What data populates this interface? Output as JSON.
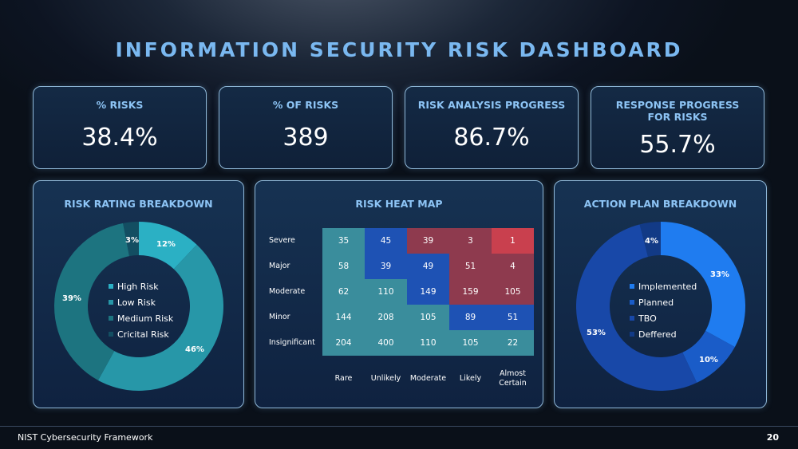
{
  "title": "INFORMATION SECURITY RISK DASHBOARD",
  "kpis": [
    {
      "label": "% RISKS",
      "value": "38.4%"
    },
    {
      "label": "% OF RISKS",
      "value": "389"
    },
    {
      "label": "RISK ANALYSIS PROGRESS",
      "value": "86.7%"
    },
    {
      "label_line1": "RESPONSE PROGRESS",
      "label_line2": "FOR RISKS",
      "value": "55.7%"
    }
  ],
  "panels": {
    "rating": "RISK RATING BREAKDOWN",
    "heatmap": "RISK HEAT MAP",
    "action": "ACTION PLAN BREAKDOWN"
  },
  "rating_legend": [
    "High Risk",
    "Low Risk",
    "Medium Risk",
    "Cricital Risk"
  ],
  "action_legend": [
    "Implemented",
    "Planned",
    "TBO",
    "Deffered"
  ],
  "colors": {
    "high": "#2bb0c4",
    "low": "#2797a8",
    "medium": "#1d7480",
    "critical": "#134e62",
    "implemented": "#1f7cf0",
    "planned": "#1a5cc8",
    "tbo": "#1848a8",
    "deffered": "#123a86",
    "hm_teal": "#3a8d9c",
    "hm_blue": "#1e52b4",
    "hm_maroon": "#8e3a4e",
    "hm_red": "#c9404e"
  },
  "chart_data": [
    {
      "type": "pie",
      "title": "RISK RATING BREAKDOWN",
      "labels": [
        "High Risk",
        "Low Risk",
        "Medium Risk",
        "Cricital Risk"
      ],
      "values": [
        12,
        46,
        39,
        3
      ],
      "value_labels": [
        "12%",
        "46%",
        "39%",
        "3%"
      ]
    },
    {
      "type": "heatmap",
      "title": "RISK HEAT MAP",
      "rows": [
        "Severe",
        "Major",
        "Moderate",
        "Minor",
        "Insignificant"
      ],
      "columns": [
        "Rare",
        "Unlikely",
        "Moderate",
        "Likely",
        "Almost Certain"
      ],
      "values": [
        [
          35,
          45,
          39,
          3,
          1
        ],
        [
          58,
          39,
          49,
          51,
          4
        ],
        [
          62,
          110,
          149,
          159,
          105
        ],
        [
          144,
          208,
          105,
          89,
          51
        ],
        [
          204,
          400,
          110,
          105,
          22
        ]
      ],
      "cell_levels": [
        [
          "teal",
          "blue",
          "maroon",
          "maroon",
          "red"
        ],
        [
          "teal",
          "blue",
          "blue",
          "maroon",
          "maroon"
        ],
        [
          "teal",
          "teal",
          "blue",
          "maroon",
          "maroon"
        ],
        [
          "teal",
          "teal",
          "teal",
          "blue",
          "blue"
        ],
        [
          "teal",
          "teal",
          "teal",
          "teal",
          "teal"
        ]
      ]
    },
    {
      "type": "pie",
      "title": "ACTION PLAN BREAKDOWN",
      "labels": [
        "Implemented",
        "Planned",
        "TBO",
        "Deffered"
      ],
      "values": [
        33,
        10,
        53,
        4
      ],
      "value_labels": [
        "33%",
        "10%",
        "53%",
        "4%"
      ]
    }
  ],
  "footer": {
    "left": "NIST Cybersecurity Framework",
    "page": "20"
  }
}
